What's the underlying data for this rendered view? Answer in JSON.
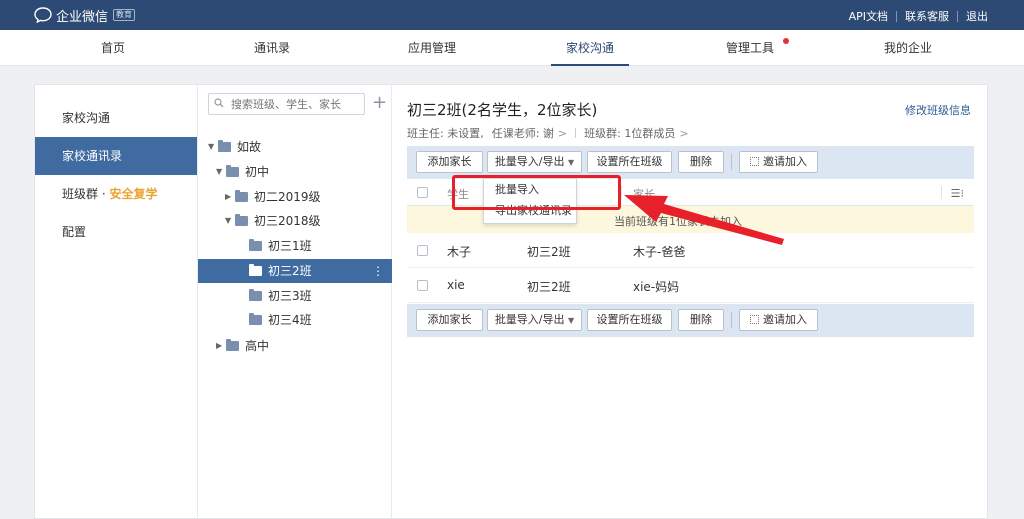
{
  "header": {
    "logo_text": "企业微信",
    "logo_badge": "教育",
    "links": [
      "API文档",
      "联系客服",
      "退出"
    ]
  },
  "nav": {
    "items": [
      "首页",
      "通讯录",
      "应用管理",
      "家校沟通",
      "管理工具",
      "我的企业"
    ],
    "active": "家校沟通",
    "notification_on": "管理工具"
  },
  "sidebar": {
    "items": [
      {
        "label": "家校沟通"
      },
      {
        "label": "家校通讯录",
        "active": true
      },
      {
        "label": "班级群 · ",
        "tag": "安全复学"
      },
      {
        "label": "配置"
      }
    ]
  },
  "tree": {
    "search_placeholder": "搜索班级、学生、家长",
    "add": "+",
    "nodes": [
      {
        "label": "如故",
        "expanded": true
      },
      {
        "label": "初中",
        "expanded": true
      },
      {
        "label": "初二2019级",
        "expanded": false
      },
      {
        "label": "初三2018级",
        "expanded": true
      },
      {
        "label": "初三1班"
      },
      {
        "label": "初三2班",
        "selected": true
      },
      {
        "label": "初三3班"
      },
      {
        "label": "初三4班"
      },
      {
        "label": "高中",
        "expanded": false
      }
    ]
  },
  "main": {
    "title": "初三2班(2名学生，2位家长)",
    "edit_link": "修改班级信息",
    "head_teacher": "班主任: 未设置,",
    "subject_teacher": "任课老师: 谢",
    "group_info": "班级群: 1位群成员",
    "toolbar": {
      "add_parent": "添加家长",
      "batch": "批量导入/导出",
      "set_class": "设置所在班级",
      "delete": "删除",
      "invite": "邀请加入"
    },
    "columns": {
      "student": "学生",
      "class": "班级",
      "parent": "家长"
    },
    "notice": "当前班级有1位家长未加入",
    "rows": [
      {
        "student": "木子",
        "class": "初三2班",
        "parent": "木子-爸爸"
      },
      {
        "student": "xie",
        "class": "初三2班",
        "parent": "xie-妈妈"
      }
    ]
  },
  "dropdown": {
    "items": [
      "批量导入",
      "导出家校通讯录"
    ]
  },
  "colors": {
    "topbar": "#2c4a73",
    "active_menu": "#3f6ba0",
    "annotation_red": "#e8202a",
    "notice_bg": "#fdf7dd",
    "tag_orange": "#e9a531"
  }
}
